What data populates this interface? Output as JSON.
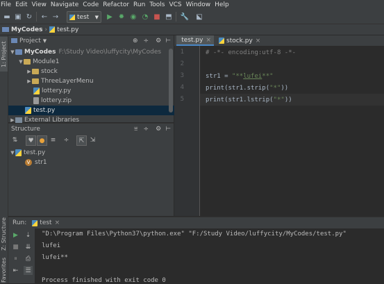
{
  "menu": [
    "File",
    "Edit",
    "View",
    "Navigate",
    "Code",
    "Refactor",
    "Run",
    "Tools",
    "VCS",
    "Window",
    "Help"
  ],
  "toolbar": {
    "run_config": "test"
  },
  "breadcrumb": {
    "project": "MyCodes",
    "file": "test.py"
  },
  "left_stripe": {
    "project_tab": "1: Project",
    "structure_tab": "Z: Structure",
    "favorites_tab": "Favorites"
  },
  "project_panel": {
    "title": "Project",
    "root": {
      "name": "MyCodes",
      "path": "F:\\Study Video\\luffycity\\MyCodes"
    },
    "items": [
      {
        "label": "Module1"
      },
      {
        "label": "stock"
      },
      {
        "label": "ThreeLayerMenu"
      },
      {
        "label": "lottery.py"
      },
      {
        "label": "lottery.zip"
      },
      {
        "label": "test.py"
      },
      {
        "label": "External Libraries"
      }
    ]
  },
  "structure_panel": {
    "title": "Structure",
    "root": "test.py",
    "child_badge": "V",
    "child": "str1"
  },
  "editor": {
    "tabs": [
      {
        "label": "test.py",
        "active": true
      },
      {
        "label": "stock.py",
        "active": false
      }
    ],
    "line_numbers": [
      "1",
      "2",
      "3",
      "4",
      "5"
    ],
    "lines": {
      "l1": "# -*- encoding:utf-8 -*-",
      "l3_var": "str1 = ",
      "l3_str_a": "\"**",
      "l3_str_b": "lufei",
      "l3_str_c": "**\"",
      "l4_a": "print(str1.strip(",
      "l4_str": "\"*\"",
      "l4_b": "))",
      "l5_a": "print(str1.lstrip(",
      "l5_str": "\"*\"",
      "l5_b": "))"
    }
  },
  "run_panel": {
    "label": "Run:",
    "tab": "test",
    "console": [
      "\"D:\\Program Files\\Python37\\python.exe\" \"F:/Study Video/luffycity/MyCodes/test.py\"",
      "lufei",
      "lufei**",
      "",
      "Process finished with exit code 0"
    ]
  },
  "colors": {
    "accent": "#4a88c7",
    "selection": "#0d293e",
    "string": "#6a8759",
    "comment": "#808080"
  }
}
